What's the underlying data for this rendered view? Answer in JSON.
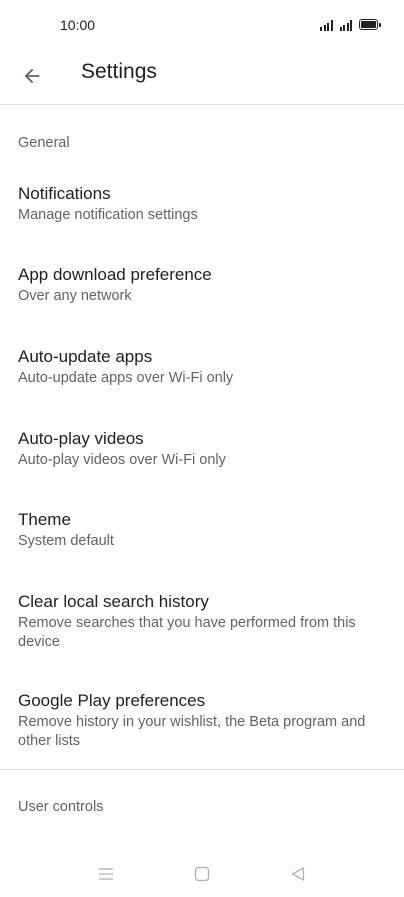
{
  "status_bar": {
    "time": "10:00",
    "icons": [
      "signal-icon",
      "signal-icon",
      "battery-icon"
    ]
  },
  "app_bar": {
    "back_icon": "arrow-back-icon",
    "title": "Settings"
  },
  "sections": {
    "general": {
      "header": "General",
      "items": [
        {
          "title": "Notifications",
          "subtitle": "Manage notification settings"
        },
        {
          "title": "App download preference",
          "subtitle": "Over any network"
        },
        {
          "title": "Auto-update apps",
          "subtitle": "Auto-update apps over Wi-Fi only"
        },
        {
          "title": "Auto-play videos",
          "subtitle": "Auto-play videos over Wi-Fi only"
        },
        {
          "title": "Theme",
          "subtitle": "System default"
        },
        {
          "title": "Clear local search history",
          "subtitle": "Remove searches that you have performed from this device"
        },
        {
          "title": "Google Play preferences",
          "subtitle": "Remove history in your wishlist, the Beta program and other lists"
        }
      ]
    },
    "user_controls": {
      "header": "User controls"
    }
  },
  "nav_bar": {
    "icons": [
      "menu-icon",
      "home-square-icon",
      "back-triangle-icon"
    ]
  },
  "colors": {
    "text_primary": "#202124",
    "text_secondary": "#5f6368",
    "divider": "#e0e0e0",
    "nav_icon": "#b0b0b0"
  }
}
